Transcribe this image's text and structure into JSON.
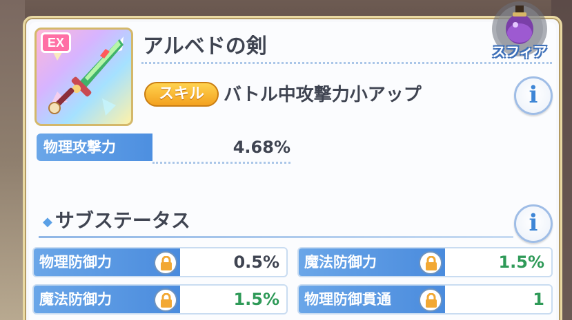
{
  "item": {
    "badge": "EX",
    "name": "アルベドの剣",
    "icon": "sword-icon"
  },
  "sphere": {
    "label": "スフィア",
    "icon": "sphere-flask-icon"
  },
  "skill": {
    "badge_label": "スキル",
    "name": "バトル中攻撃力小アップ",
    "info_icon": "i"
  },
  "main_stat": {
    "label": "物理攻撃力",
    "value": "4.68%"
  },
  "sub_status": {
    "title": "サブステータス",
    "info_icon": "i",
    "stats": [
      {
        "label": "物理防御力",
        "value": "0.5%",
        "value_color": "#3f4451"
      },
      {
        "label": "魔法防御力",
        "value": "1.5%",
        "value_color": "#2f9a58"
      },
      {
        "label": "魔法防御力",
        "value": "1.5%",
        "value_color": "#2f9a58"
      },
      {
        "label": "物理防御貫通",
        "value": "1",
        "value_color": "#2f9a58"
      }
    ]
  },
  "colors": {
    "panel_border": "#e9d9a3",
    "label_blue": "#4d8fe0",
    "skill_orange": "#f3a11f",
    "bonus_green": "#2f9a58"
  }
}
